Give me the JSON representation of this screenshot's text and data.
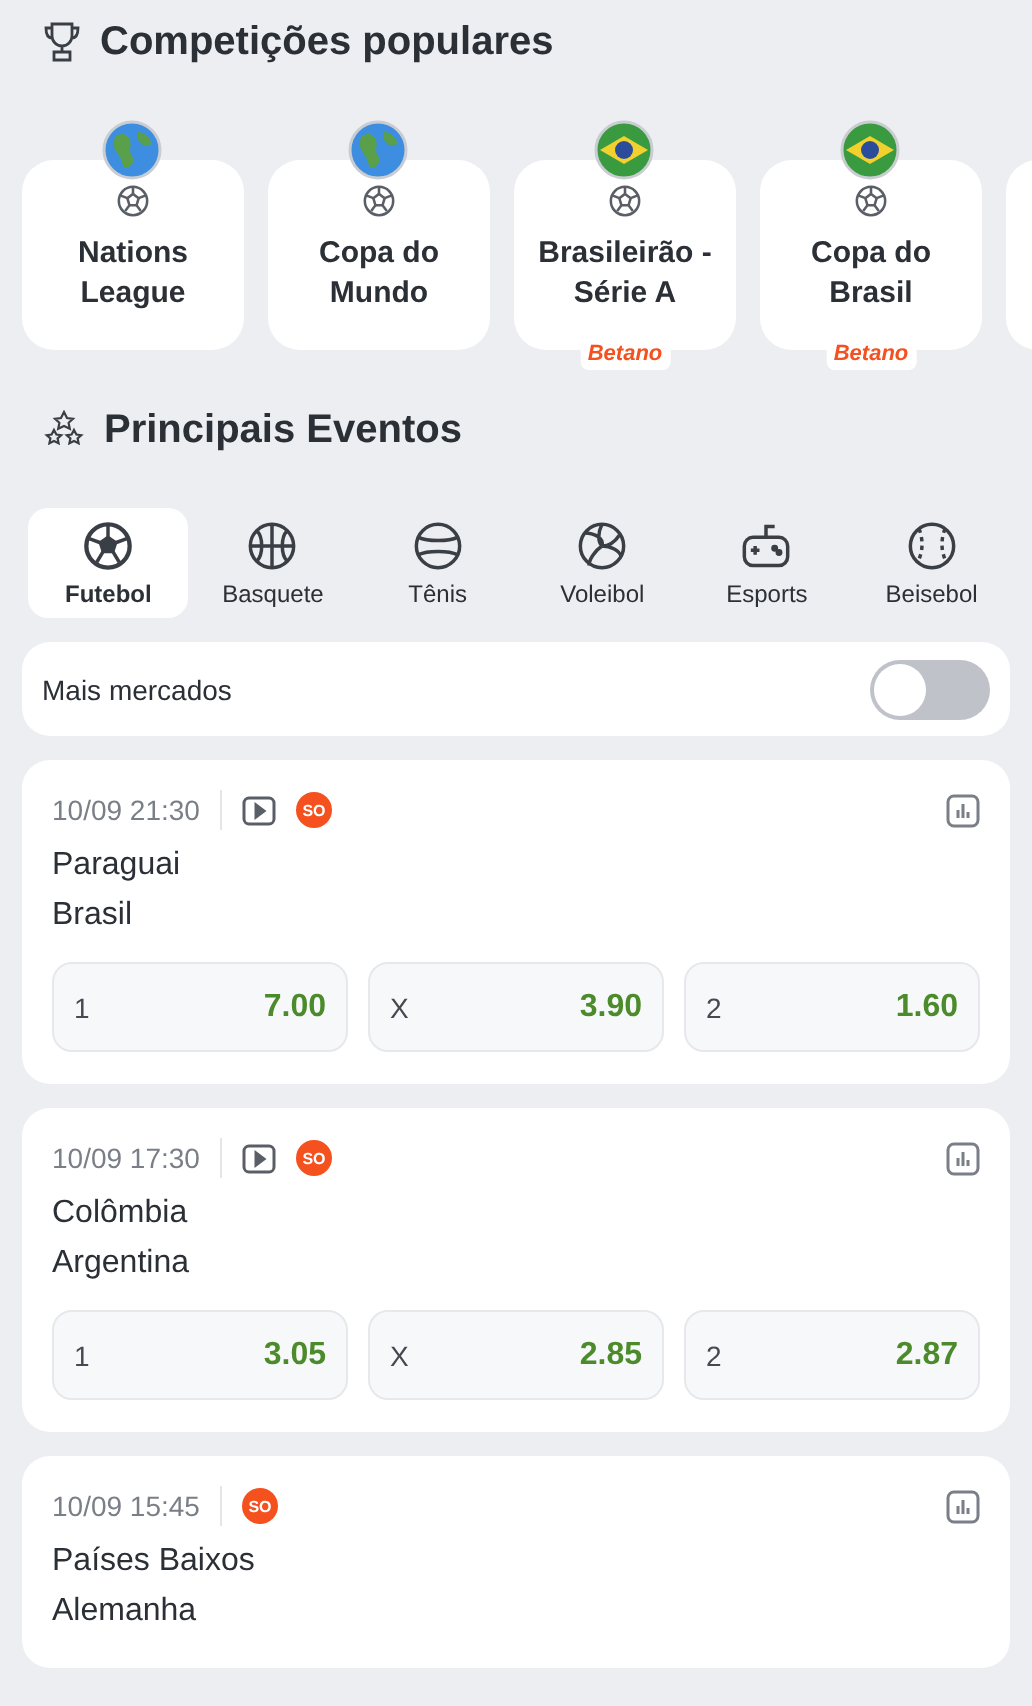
{
  "competitions_section": {
    "title": "Competições populares"
  },
  "competitions": [
    {
      "name": "Nations League",
      "kind": "world"
    },
    {
      "name": "Copa do Mundo",
      "kind": "world"
    },
    {
      "name": "Brasileirão - Série A",
      "kind": "brazil",
      "sponsor": "Betano"
    },
    {
      "name": "Copa do Brasil",
      "kind": "brazil",
      "sponsor": "Betano"
    }
  ],
  "events_section": {
    "title": "Principais Eventos"
  },
  "sport_tabs": [
    {
      "label": "Futebol",
      "kind": "football",
      "selected": true
    },
    {
      "label": "Basquete",
      "kind": "basketball",
      "selected": false
    },
    {
      "label": "Tênis",
      "kind": "tennis",
      "selected": false
    },
    {
      "label": "Voleibol",
      "kind": "volleyball",
      "selected": false
    },
    {
      "label": "Esports",
      "kind": "gamepad",
      "selected": false
    },
    {
      "label": "Beisebol",
      "kind": "baseball",
      "selected": false
    }
  ],
  "more_markets": {
    "label": "Mais mercados",
    "on": false
  },
  "events": [
    {
      "time": "10/09 21:30",
      "stream": true,
      "badge": "SO",
      "teams": [
        "Paraguai",
        "Brasil"
      ],
      "odds": [
        {
          "label": "1",
          "value": "7.00"
        },
        {
          "label": "X",
          "value": "3.90"
        },
        {
          "label": "2",
          "value": "1.60"
        }
      ]
    },
    {
      "time": "10/09 17:30",
      "stream": true,
      "badge": "SO",
      "teams": [
        "Colômbia",
        "Argentina"
      ],
      "odds": [
        {
          "label": "1",
          "value": "3.05"
        },
        {
          "label": "X",
          "value": "2.85"
        },
        {
          "label": "2",
          "value": "2.87"
        }
      ]
    },
    {
      "time": "10/09 15:45",
      "stream": false,
      "badge": "SO",
      "teams": [
        "Países Baixos",
        "Alemanha"
      ]
    }
  ]
}
